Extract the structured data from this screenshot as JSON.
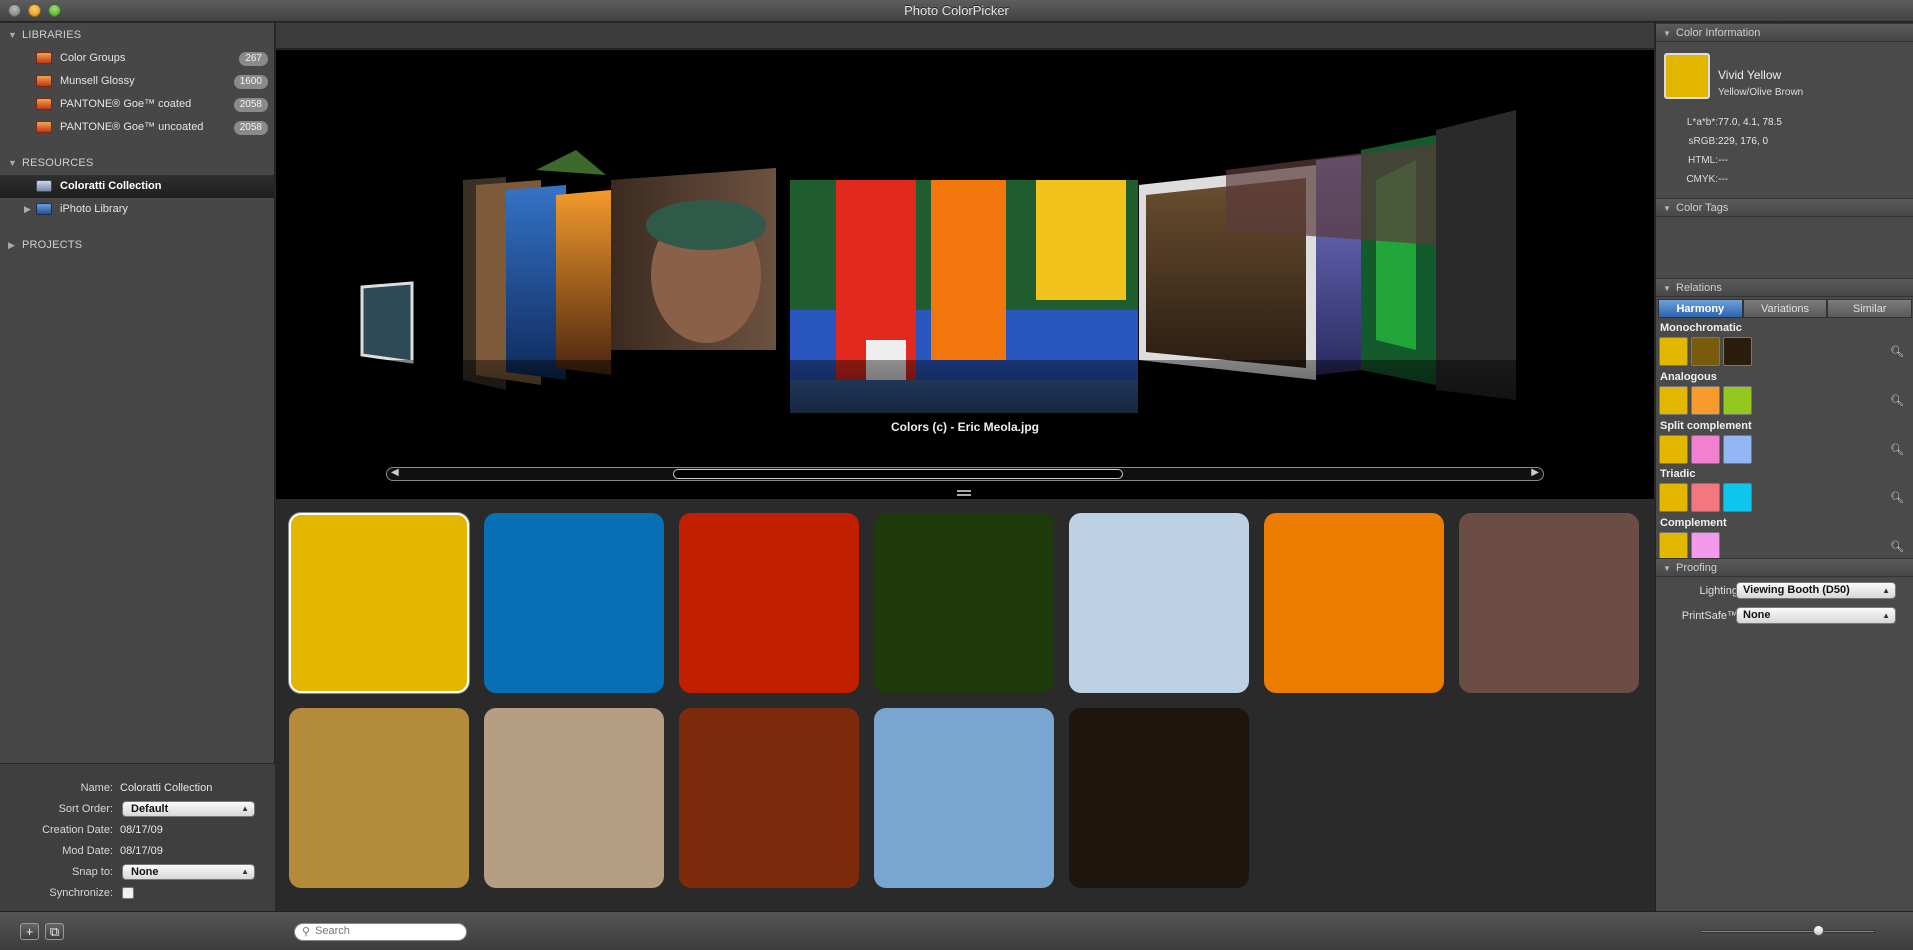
{
  "window": {
    "title": "Photo ColorPicker"
  },
  "sidebar": {
    "libraries_label": "LIBRARIES",
    "libraries": [
      {
        "label": "Color Groups",
        "count": "267"
      },
      {
        "label": "Munsell Glossy",
        "count": "1600"
      },
      {
        "label": "PANTONE® Goe™ coated",
        "count": "2058"
      },
      {
        "label": "PANTONE® Goe™ uncoated",
        "count": "2058"
      }
    ],
    "resources_label": "RESOURCES",
    "resources": [
      {
        "label": "Coloratti Collection"
      },
      {
        "label": "iPhoto Library"
      }
    ],
    "projects_label": "PROJECTS"
  },
  "info": {
    "name_label": "Name:",
    "name_value": "Coloratti Collection",
    "sort_label": "Sort Order:",
    "sort_value": "Default",
    "creation_label": "Creation Date:",
    "creation_value": "08/17/09",
    "mod_label": "Mod Date:",
    "mod_value": "08/17/09",
    "snap_label": "Snap to:",
    "snap_value": "None",
    "sync_label": "Synchronize:"
  },
  "coverflow": {
    "caption": "Colors (c) - Eric Meola.jpg"
  },
  "swatches": [
    "#E3B600",
    "#0770B5",
    "#C21F00",
    "#1E3A0A",
    "#BCD1E4",
    "#EC7C02",
    "#6B4D45",
    "#B48B3B",
    "#B59E84",
    "#7E2A0D",
    "#78A6D0",
    "#1E150E"
  ],
  "bottom": {
    "search_placeholder": "Search",
    "add": "+",
    "aux": "⧉"
  },
  "color_info": {
    "header": "Color Information",
    "name": "Vivid Yellow",
    "sub": "Yellow/Olive Brown",
    "swatch": "#E3B600",
    "rows": [
      {
        "label": "L*a*b*:",
        "value": "77.0, 4.1, 78.5"
      },
      {
        "label": "sRGB:",
        "value": "229, 176, 0"
      },
      {
        "label": "HTML:",
        "value": "---"
      },
      {
        "label": "CMYK:",
        "value": "---"
      }
    ]
  },
  "color_tags": {
    "header": "Color Tags"
  },
  "relations": {
    "header": "Relations",
    "tabs": [
      "Harmony",
      "Variations",
      "Similar"
    ],
    "groups": [
      {
        "title": "Monochromatic",
        "colors": [
          "#E3B600",
          "#7A5B0C",
          "#2A1D0B"
        ]
      },
      {
        "title": "Analogous",
        "colors": [
          "#E3B600",
          "#F79C2C",
          "#95C81F"
        ]
      },
      {
        "title": "Split complement",
        "colors": [
          "#E3B600",
          "#F27FCF",
          "#93B6F5"
        ]
      },
      {
        "title": "Triadic",
        "colors": [
          "#E3B600",
          "#F2777F",
          "#0FC7EE"
        ]
      },
      {
        "title": "Complement",
        "colors": [
          "#E3B600",
          "#F49AEC"
        ]
      }
    ]
  },
  "proofing": {
    "header": "Proofing",
    "lighting_label": "Lighting",
    "lighting_value": "Viewing Booth (D50)",
    "printsafe_label": "PrintSafe™",
    "printsafe_value": "None"
  }
}
